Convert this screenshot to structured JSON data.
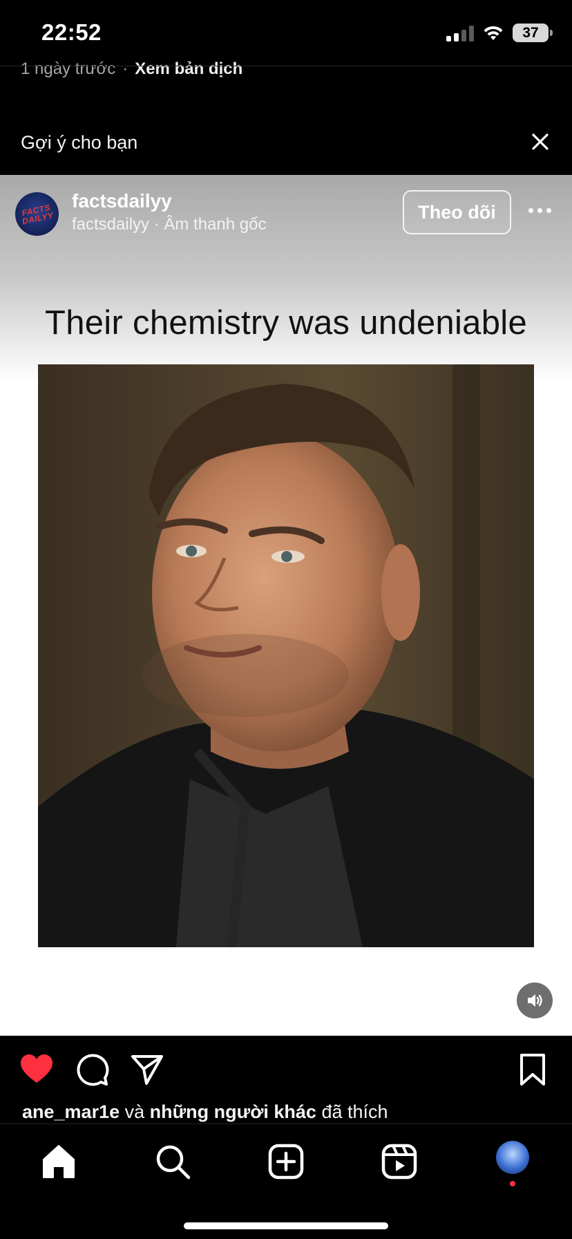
{
  "status_bar": {
    "time": "22:52",
    "battery": "37"
  },
  "previous_post": {
    "time_ago": "1 ngày trước",
    "separator": "·",
    "translate_link": "Xem bản dịch"
  },
  "suggestions": {
    "title": "Gợi ý cho bạn"
  },
  "post": {
    "username": "factsdailyy",
    "subline": "factsdailyy · Âm thanh gốc",
    "follow_label": "Theo dõi",
    "avatar_text": "FACTS DAILYY",
    "caption": "Their chemistry was undeniable",
    "liked": true
  },
  "likes": {
    "user": "ane_mar1e",
    "connector": " và ",
    "others": "những người khác",
    "suffix": " đã thích"
  },
  "icons": {
    "close": "close-icon",
    "more": "more-options-icon",
    "mute": "speaker-icon",
    "like": "heart-icon",
    "comment": "comment-icon",
    "share": "send-icon",
    "save": "bookmark-icon",
    "home": "home-icon",
    "search": "search-icon",
    "create": "plus-square-icon",
    "reels": "reels-icon",
    "profile": "avatar"
  },
  "colors": {
    "like_active": "#ff3040",
    "background": "#000000",
    "notification_dot": "#ff3040"
  }
}
